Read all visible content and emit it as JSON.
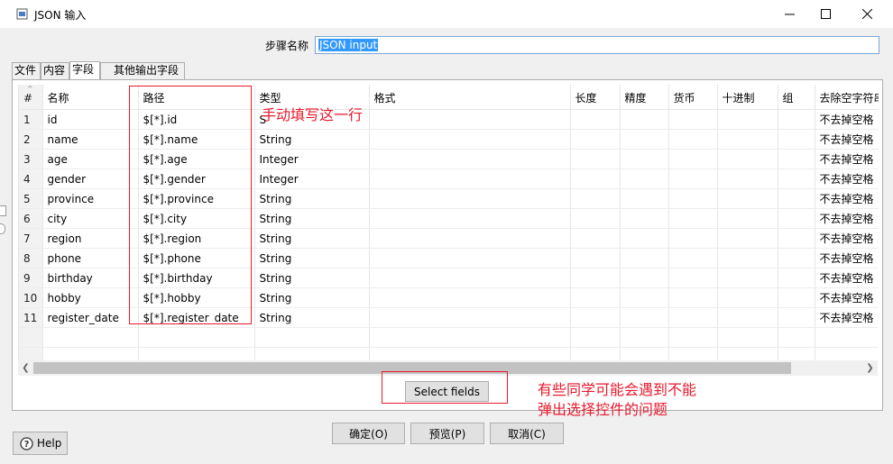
{
  "window": {
    "title": "JSON 输入"
  },
  "step": {
    "label": "步骤名称",
    "value": "JSON input"
  },
  "tabs": [
    {
      "label": "文件",
      "active": false
    },
    {
      "label": "内容",
      "active": false
    },
    {
      "label": "字段",
      "active": true
    },
    {
      "label": "其他输出字段",
      "active": false
    }
  ],
  "table": {
    "columns": [
      "#",
      "名称",
      "路径",
      "类型",
      "格式",
      "长度",
      "精度",
      "货币",
      "十进制",
      "组",
      "去除空字符串"
    ],
    "rows": [
      {
        "num": "1",
        "name": "id",
        "path": "$[*].id",
        "type": "S"
      },
      {
        "num": "2",
        "name": "name",
        "path": "$[*].name",
        "type": "String"
      },
      {
        "num": "3",
        "name": "age",
        "path": "$[*].age",
        "type": "Integer"
      },
      {
        "num": "4",
        "name": "gender",
        "path": "$[*].gender",
        "type": "Integer"
      },
      {
        "num": "5",
        "name": "province",
        "path": "$[*].province",
        "type": "String"
      },
      {
        "num": "6",
        "name": "city",
        "path": "$[*].city",
        "type": "String"
      },
      {
        "num": "7",
        "name": "region",
        "path": "$[*].region",
        "type": "String"
      },
      {
        "num": "8",
        "name": "phone",
        "path": "$[*].phone",
        "type": "String"
      },
      {
        "num": "9",
        "name": "birthday",
        "path": "$[*].birthday",
        "type": "String"
      },
      {
        "num": "10",
        "name": "hobby",
        "path": "$[*].hobby",
        "type": "String"
      },
      {
        "num": "11",
        "name": "register_date",
        "path": "$[*].register_date",
        "type": "String"
      }
    ],
    "trim_value": "不去掉空格"
  },
  "buttons": {
    "select_fields": "Select fields",
    "ok": "确定(O)",
    "preview": "预览(P)",
    "cancel": "取消(C)",
    "help": "Help"
  },
  "annotations": {
    "fill_row": "手动填写这一行",
    "popup_line1": "有些同学可能会遇到不能",
    "popup_line2": "弹出选择控件的问题"
  },
  "colors": {
    "annotation": "#e8192c",
    "selection": "#3399ff"
  }
}
